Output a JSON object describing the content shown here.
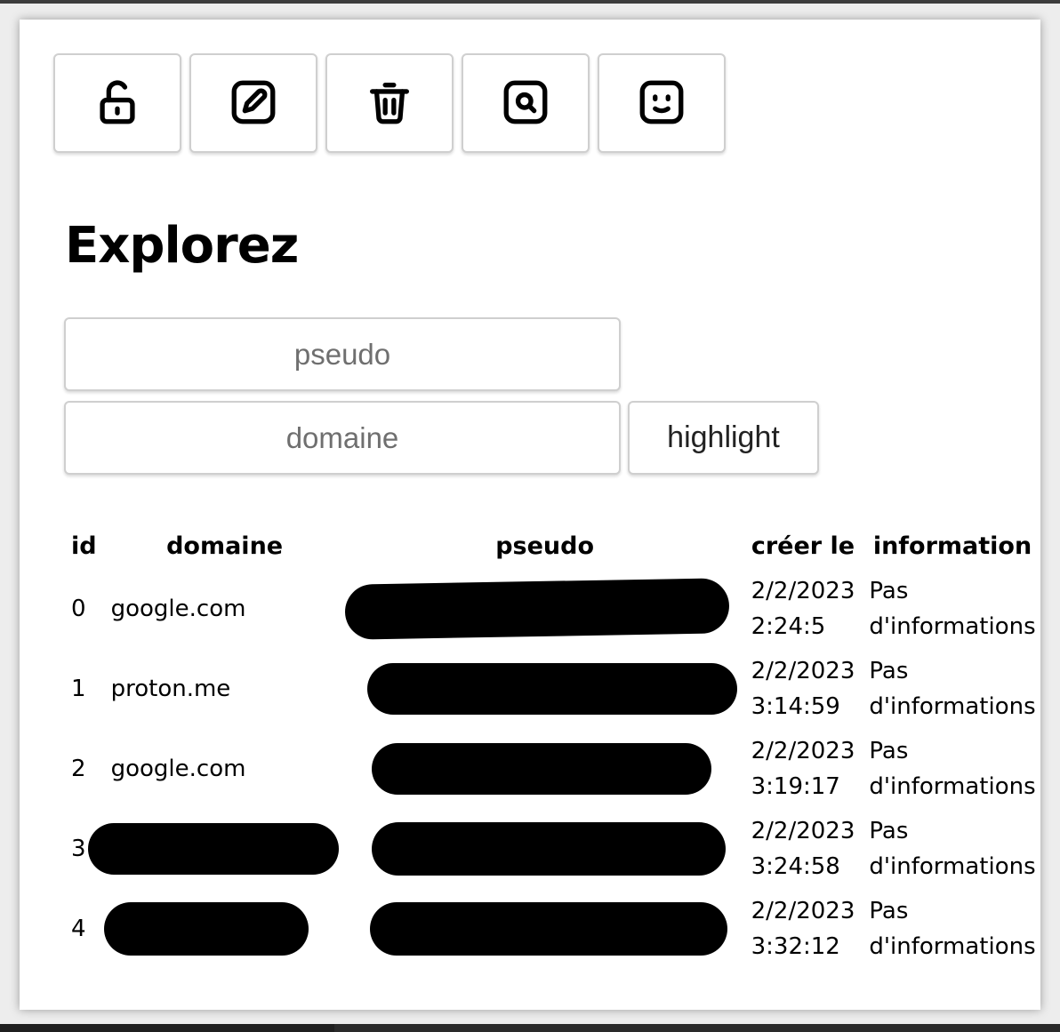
{
  "toolbar": {
    "buttons": [
      {
        "icon": "unlock-icon"
      },
      {
        "icon": "edit-icon"
      },
      {
        "icon": "trash-icon"
      },
      {
        "icon": "search-icon"
      },
      {
        "icon": "smiley-icon"
      }
    ]
  },
  "page_title": "Explorez",
  "filters": {
    "pseudo_placeholder": "pseudo",
    "domaine_placeholder": "domaine",
    "highlight_label": "highlight"
  },
  "table": {
    "headers": {
      "id": "id",
      "domaine": "domaine",
      "pseudo": "pseudo",
      "date": "créer le",
      "info": "information"
    },
    "rows": [
      {
        "id": "0",
        "domaine": "google.com",
        "date": "2/2/2023",
        "time": "2:24:5",
        "info1": "Pas",
        "info2": "d'informations"
      },
      {
        "id": "1",
        "domaine": "proton.me",
        "date": "2/2/2023",
        "time": "3:14:59",
        "info1": "Pas",
        "info2": "d'informations"
      },
      {
        "id": "2",
        "domaine": "google.com",
        "date": "2/2/2023",
        "time": "3:19:17",
        "info1": "Pas",
        "info2": "d'informations"
      },
      {
        "id": "3",
        "domaine": "",
        "date": "2/2/2023",
        "time": "3:24:58",
        "info1": "Pas",
        "info2": "d'informations"
      },
      {
        "id": "4",
        "domaine": "",
        "date": "2/2/2023",
        "time": "3:32:12",
        "info1": "Pas",
        "info2": "d'informations"
      }
    ]
  }
}
